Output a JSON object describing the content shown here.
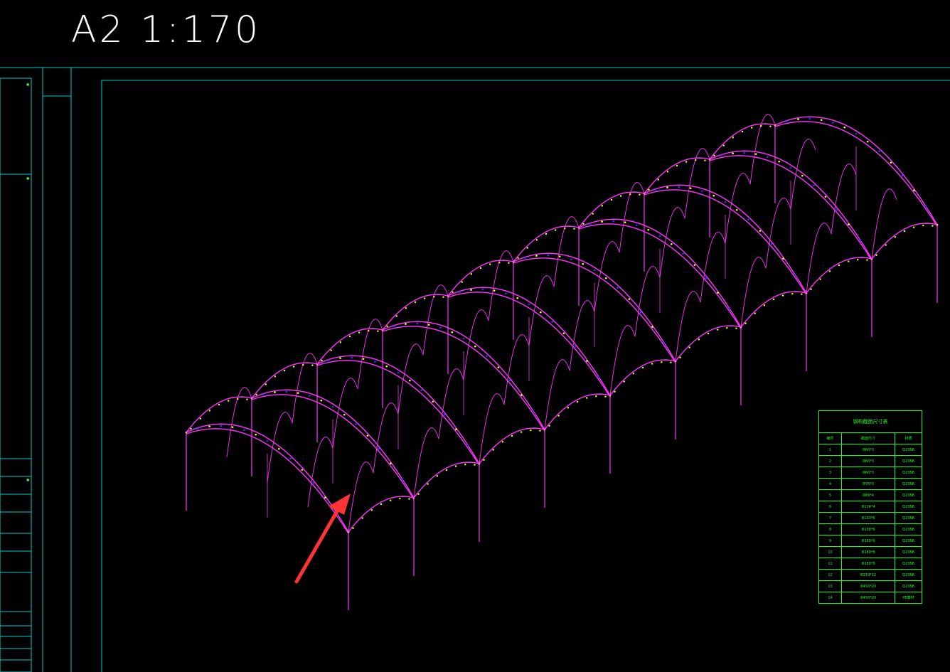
{
  "drawing": {
    "title": "A2  1:170"
  },
  "table": {
    "title": "钢构截面尺寸表",
    "headers": [
      "编号",
      "截面尺寸",
      "材质"
    ],
    "rows": [
      [
        "1",
        "Φ60*3",
        "Q235B"
      ],
      [
        "2",
        "Φ60*3",
        "Q235B"
      ],
      [
        "3",
        "Φ60*3",
        "Q235B"
      ],
      [
        "4",
        "Φ76*3",
        "Q235B"
      ],
      [
        "5",
        "Φ89*4",
        "Q235B"
      ],
      [
        "6",
        "Φ114*4",
        "Q235B"
      ],
      [
        "7",
        "Φ133*6",
        "Q235B"
      ],
      [
        "8",
        "Φ168*6",
        "Q235B"
      ],
      [
        "9",
        "Φ180*6",
        "Q235B"
      ],
      [
        "10",
        "Φ180*8",
        "Q235B"
      ],
      [
        "11",
        "Φ180*8",
        "Q235B"
      ],
      [
        "12",
        "Φ219*12",
        "Q235B"
      ],
      [
        "13",
        "Φ450*20",
        "Q235B"
      ],
      [
        "14",
        "Φ450*20",
        "PE膜材"
      ]
    ]
  },
  "colors": {
    "background": "#000000",
    "frame": "#00cccc",
    "truss": "#ff33ff",
    "node": "#ffff33",
    "brace": "#3333ff",
    "table": "#1aff1a",
    "annotation_arrow": "#ff3333"
  }
}
